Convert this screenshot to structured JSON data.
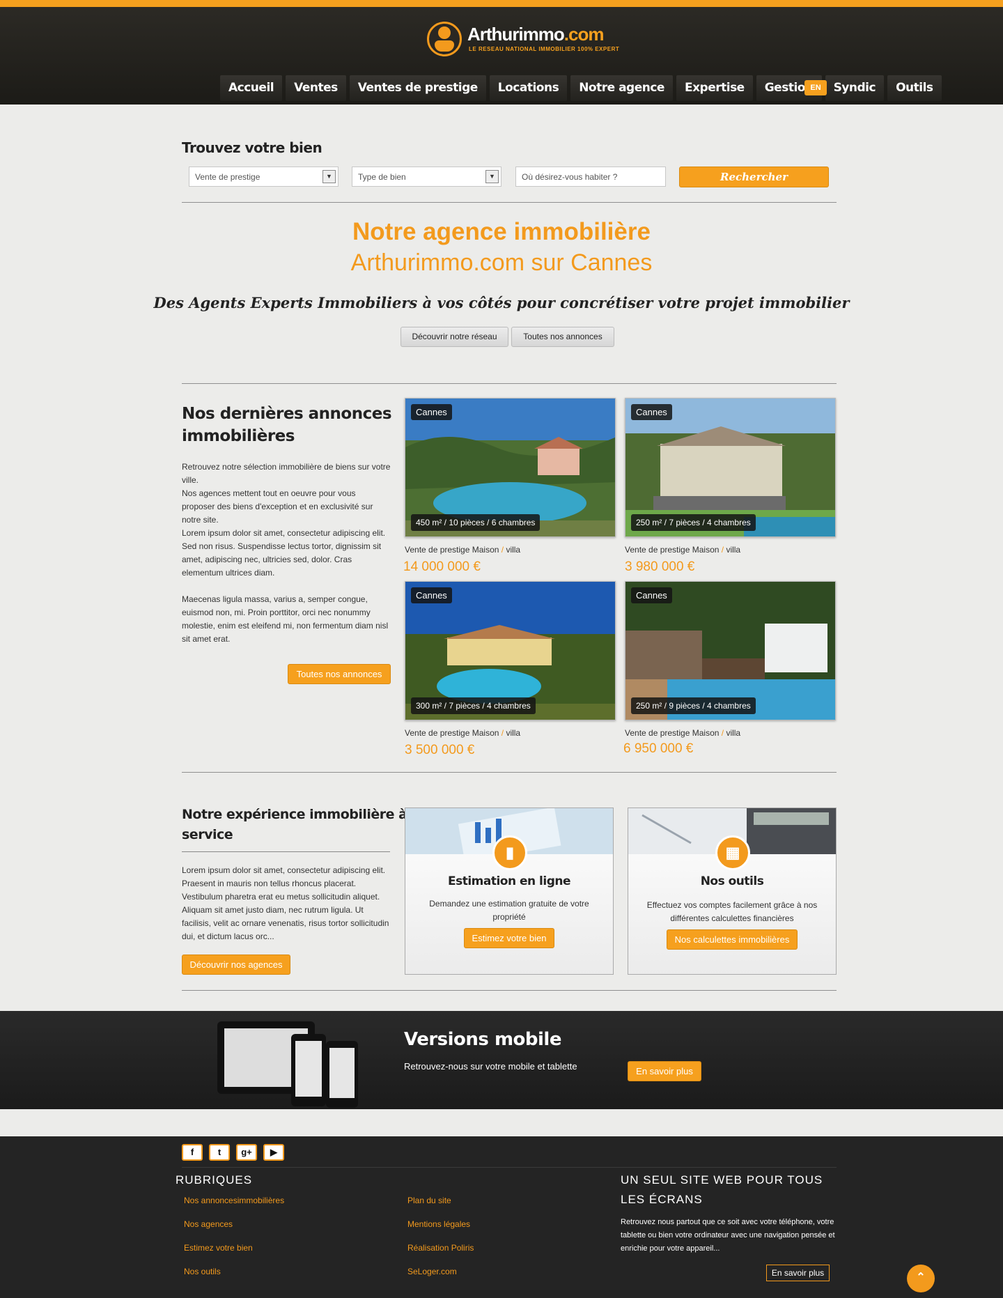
{
  "header": {
    "logo_name": "Arthurimmo",
    "logo_dot": ".com",
    "logo_tagline": "LE RESEAU NATIONAL IMMOBILIER 100% EXPERT",
    "nav": [
      "Accueil",
      "Ventes",
      "Ventes de prestige",
      "Locations",
      "Notre agence",
      "Expertise",
      "Gestion",
      "Syndic",
      "Outils"
    ],
    "lang": "EN"
  },
  "search": {
    "title": "Trouvez votre bien",
    "transaction_value": "Vente de prestige",
    "type_placeholder": "Type de bien",
    "location_placeholder": "Où désirez-vous habiter ?",
    "button": "Rechercher"
  },
  "hero": {
    "title": "Notre agence immobilière",
    "subtitle": "Arthurimmo.com sur Cannes",
    "tagline": "Des Agents Experts Immobiliers à vos côtés pour concrétiser votre projet immobilier",
    "btn_network": "Découvrir notre réseau",
    "btn_listings": "Toutes nos annonces"
  },
  "listings": {
    "title_line1": "Nos dernières annonces",
    "title_line2": "immobilières",
    "paragraph1": "Retrouvez notre sélection immobilière de biens sur votre ville.",
    "paragraph2": "Nos agences mettent tout en oeuvre pour vous proposer des biens d'exception et en exclusivité sur notre site.",
    "paragraph3": "Lorem ipsum dolor sit amet, consectetur adipiscing elit. Sed non risus. Suspendisse lectus tortor, dignissim sit amet, adipiscing nec, ultricies sed, dolor. Cras elementum ultrices diam.",
    "paragraph4": "Maecenas ligula massa, varius a, semper congue, euismod non, mi. Proin porttitor, orci nec nonummy molestie, enim est eleifend mi, non fermentum diam nisl sit amet erat.",
    "button": "Toutes nos annonces",
    "items": [
      {
        "city": "Cannes",
        "specs": "450 m² / 10 pièces / 6 chambres",
        "type": "Vente de prestige Maison",
        "slash": " / ",
        "kind": "villa",
        "price": "14 000 000 €"
      },
      {
        "city": "Cannes",
        "specs": "250 m² / 7 pièces / 4 chambres",
        "type": "Vente de prestige Maison",
        "slash": " / ",
        "kind": "villa",
        "price": "3 980 000 €"
      },
      {
        "city": "Cannes",
        "specs": "300 m² / 7 pièces / 4 chambres",
        "type": "Vente de prestige Maison",
        "slash": " / ",
        "kind": "villa",
        "price": "3 500 000 €"
      },
      {
        "city": "Cannes",
        "specs": "250 m² / 9 pièces / 4 chambres",
        "type": "Vente de prestige Maison",
        "slash": " / ",
        "kind": "villa",
        "price": "6 950 000 €"
      }
    ]
  },
  "services": {
    "title_line1": "Notre expérience immobilière à votre",
    "title_line2": "service",
    "text": "Lorem ipsum dolor sit amet, consectetur adipiscing elit. Praesent in mauris non tellus rhoncus placerat. Vestibulum pharetra erat eu metus sollicitudin aliquet. Aliquam sit amet justo diam, nec rutrum ligula. Ut facilisis, velit ac ornare venenatis, risus tortor sollicitudin dui, et dictum lacus orc...",
    "button": "Découvrir nos agences",
    "estimation": {
      "title": "Estimation en ligne",
      "text": "Demandez une estimation gratuite de votre propriété",
      "button": "Estimez votre bien",
      "icon": "bar-chart-icon"
    },
    "tools": {
      "title": "Nos outils",
      "text": "Effectuez vos comptes facilement grâce à nos différentes calculettes financières",
      "button": "Nos calculettes immobilières",
      "icon": "calculator-icon"
    }
  },
  "mobile": {
    "title": "Versions mobile",
    "text": "Retrouvez-nous sur votre mobile et tablette",
    "button": "En savoir plus"
  },
  "footer": {
    "social": [
      "f",
      "t",
      "g+",
      "▶"
    ],
    "rubriques_title": "RUBRIQUES",
    "col1": [
      "Nos annoncesimmobilières",
      "Nos agences",
      "Estimez votre bien",
      "Nos outils"
    ],
    "col2": [
      "Plan du site",
      "Mentions légales",
      "Réalisation Poliris",
      "SeLoger.com"
    ],
    "web_title_line1": "UN SEUL SITE WEB POUR TOUS",
    "web_title_line2": "LES ÉCRANS",
    "web_text": "Retrouvez nous partout que ce soit avec votre téléphone, votre tablette ou bien votre ordinateur avec une navigation pensée et enrichie pour votre appareil...",
    "web_button": "En savoir plus",
    "to_top": "⌃"
  },
  "colors": {
    "accent": "#f6a01e",
    "dark": "#222222"
  }
}
